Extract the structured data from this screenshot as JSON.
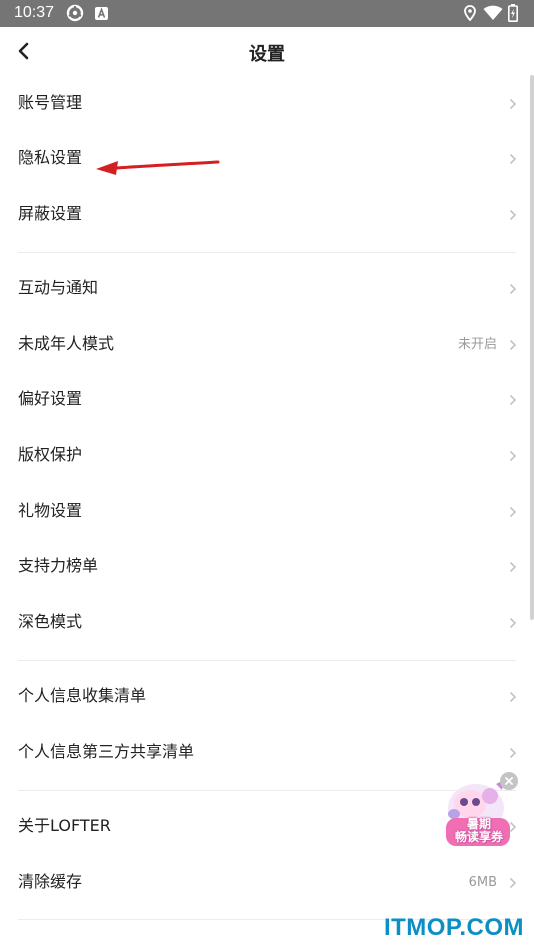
{
  "status_bar": {
    "time": "10:37"
  },
  "header": {
    "title": "设置"
  },
  "menu": {
    "group1": [
      {
        "label": "账号管理"
      },
      {
        "label": "隐私设置"
      },
      {
        "label": "屏蔽设置"
      }
    ],
    "group2": [
      {
        "label": "互动与通知"
      },
      {
        "label": "未成年人模式",
        "value": "未开启"
      },
      {
        "label": "偏好设置"
      },
      {
        "label": "版权保护"
      },
      {
        "label": "礼物设置"
      },
      {
        "label": "支持力榜单"
      },
      {
        "label": "深色模式"
      }
    ],
    "group3": [
      {
        "label": "个人信息收集清单"
      },
      {
        "label": "个人信息第三方共享清单"
      }
    ],
    "group4": [
      {
        "label": "关于LOFTER"
      },
      {
        "label": "清除缓存",
        "value": "6MB"
      }
    ]
  },
  "promo": {
    "text_line1": "暑期",
    "text_line2": "畅读享券"
  },
  "watermark": "ITMOP.COM",
  "colors": {
    "status_bar": "#757575",
    "annotation_arrow": "#d42020",
    "watermark": "#0b8fc4"
  }
}
